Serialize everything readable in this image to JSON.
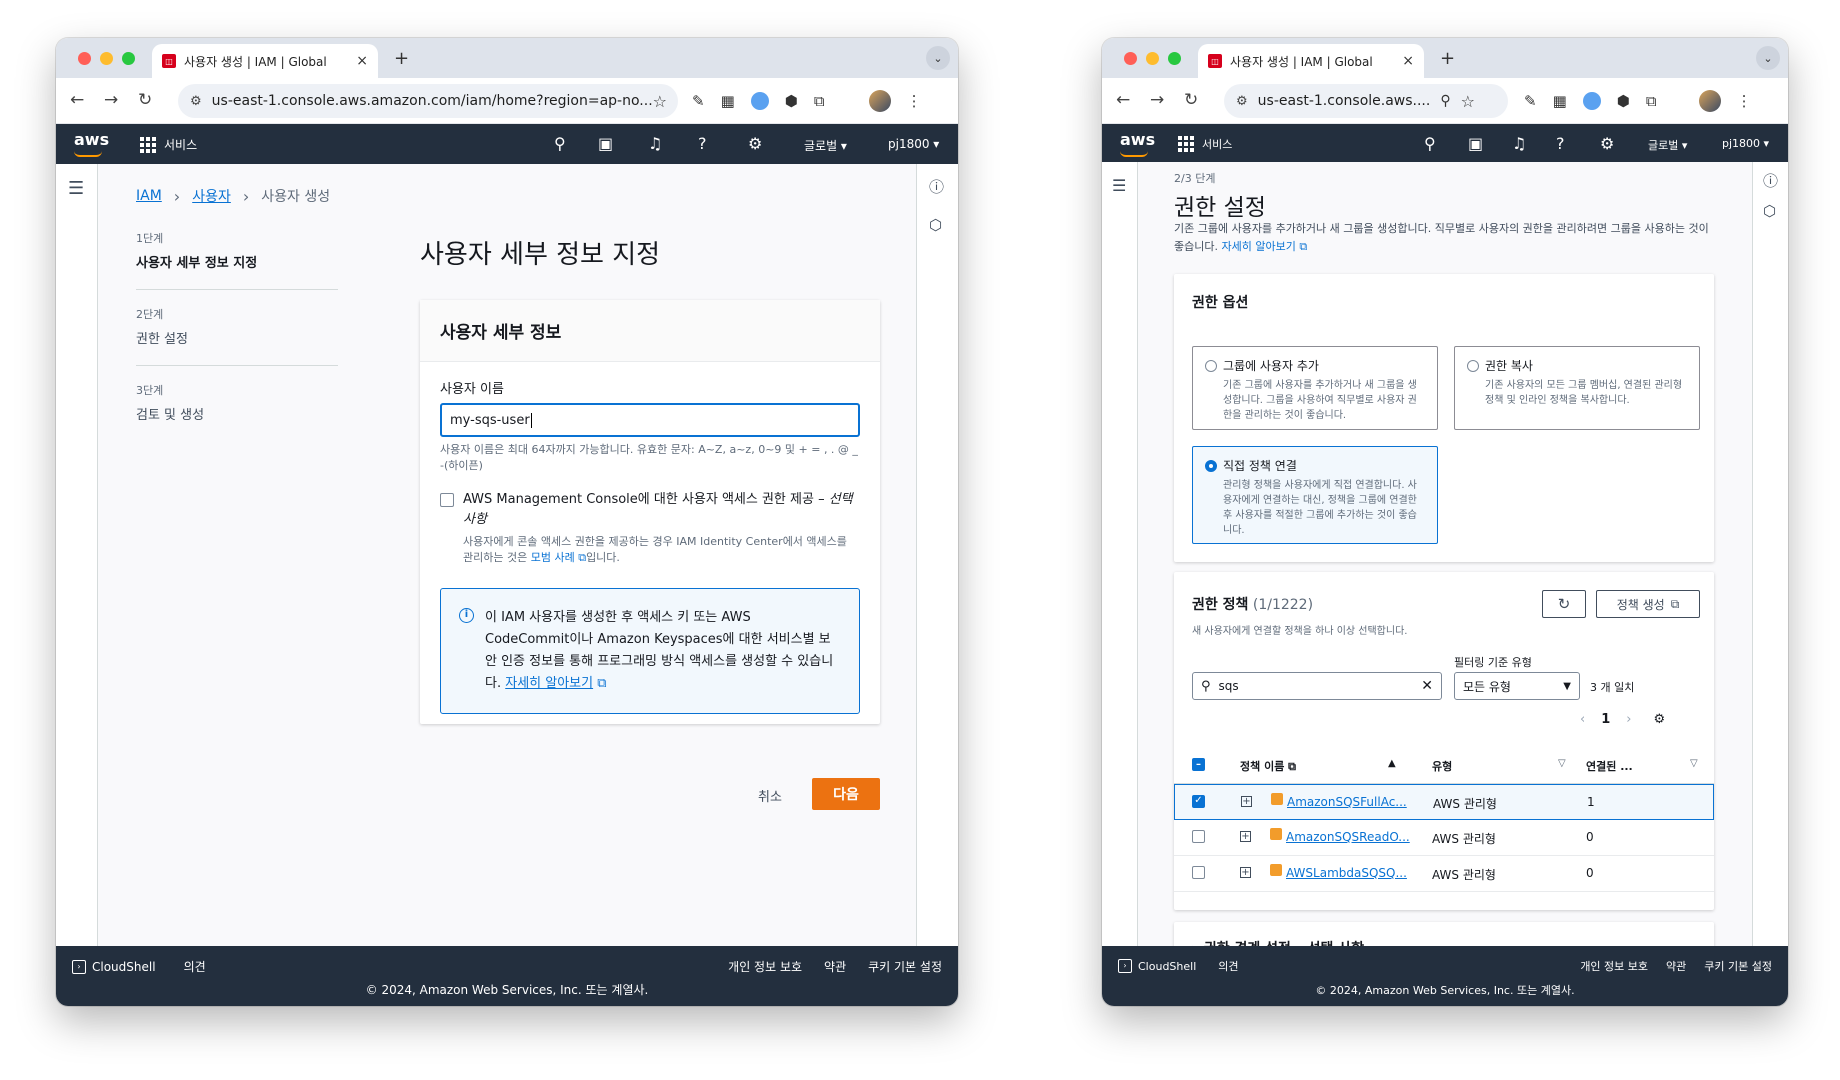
{
  "colors": {
    "aws_navy": "#232f3e",
    "aws_orange": "#ec7211",
    "link_blue": "#0972d3",
    "tab_bg": "#dee3eb"
  },
  "left_window": {
    "tab": {
      "title": "사용자 생성 | IAM | Global",
      "close": "×",
      "new": "+"
    },
    "url": "us-east-1.console.aws.amazon.com/iam/home?region=ap-no...",
    "awsbar": {
      "logo": "aws",
      "services": "서비스",
      "region": "글로벌 ▾",
      "account": "pj1800 ▾"
    },
    "breadcrumb": {
      "item1": "IAM",
      "item2": "사용자",
      "item3": "사용자 생성"
    },
    "steps": [
      {
        "num": "1단계",
        "title": "사용자 세부 정보 지정"
      },
      {
        "num": "2단계",
        "title": "권한 설정"
      },
      {
        "num": "3단계",
        "title": "검토 및 생성"
      }
    ],
    "page_title": "사용자 세부 정보 지정",
    "panel": {
      "header": "사용자 세부 정보",
      "username_label": "사용자 이름",
      "username_value": "my-sqs-user",
      "username_hint": "사용자 이름은 최대 64자까지 가능합니다. 유효한 문자: A~Z, a~z, 0~9 및 + = , . @ _ -(하이픈)",
      "console_checkbox_label": "AWS Management Console에 대한 사용자 액세스 권한 제공 – ",
      "console_checkbox_optional": "선택 사항",
      "console_hint_pre": "사용자에게 콘솔 액세스 권한을 제공하는 경우 IAM Identity Center에서 액세스를 관리하는 것은 ",
      "console_hint_link": "모범 사례",
      "console_hint_post": "입니다.",
      "info_text": "이 IAM 사용자를 생성한 후 액세스 키 또는 AWS CodeCommit이나 Amazon Keyspaces에 대한 서비스별 보안 인증 정보를 통해 프로그래밍 방식 액세스를 생성할 수 있습니다. ",
      "info_link": "자세히 알아보기"
    },
    "cancel": "취소",
    "next": "다음",
    "footer": {
      "cloudshell": "CloudShell",
      "feedback": "의견",
      "privacy": "개인 정보 보호",
      "terms": "약관",
      "cookies": "쿠키 기본 설정",
      "copyright": "© 2024, Amazon Web Services, Inc. 또는 계열사."
    }
  },
  "right_window": {
    "tab": {
      "title": "사용자 생성 | IAM | Global",
      "close": "×",
      "new": "+"
    },
    "url": "us-east-1.console.aws....",
    "awsbar": {
      "logo": "aws",
      "services": "서비스",
      "region": "글로벌 ▾",
      "account": "pj1800 ▾"
    },
    "step_label": "2/3 단계",
    "page_title": "권한 설정",
    "description": "기존 그룹에 사용자를 추가하거나 새 그룹을 생성합니다. 직무별로 사용자의 권한을 관리하려면 그룹을 사용하는 것이 좋습니다. ",
    "description_link": "자세히 알아보기",
    "options": {
      "header": "권한 옵션",
      "tiles": [
        {
          "title": "그룹에 사용자 추가",
          "desc": "기존 그룹에 사용자를 추가하거나 새 그룹을 생성합니다. 그룹을 사용하여 직무별로 사용자 권한을 관리하는 것이 좋습니다.",
          "selected": false
        },
        {
          "title": "권한 복사",
          "desc": "기존 사용자의 모든 그룹 멤버십, 연결된 관리형 정책 및 인라인 정책을 복사합니다.",
          "selected": false
        },
        {
          "title": "직접 정책 연결",
          "desc": "관리형 정책을 사용자에게 직접 연결합니다. 사용자에게 연결하는 대신, 정책을 그룹에 연결한 후 사용자를 적절한 그룹에 추가하는 것이 좋습니다.",
          "selected": true
        }
      ]
    },
    "policies": {
      "header": "권한 정책",
      "count": "(1/1222)",
      "subtitle": "새 사용자에게 연결할 정책을 하나 이상 선택합니다.",
      "create_policy": "정책 생성",
      "filter_label": "필터링 기준 유형",
      "search_value": "sqs",
      "type_select": "모든 유형",
      "match_count": "3 개 일치",
      "page": "1",
      "columns": {
        "name": "정책 이름",
        "type": "유형",
        "attached": "연결된 ..."
      },
      "rows": [
        {
          "name": "AmazonSQSFullAc...",
          "type": "AWS 관리형",
          "attached": "1",
          "checked": true
        },
        {
          "name": "AmazonSQSReadO...",
          "type": "AWS 관리형",
          "attached": "0",
          "checked": false
        },
        {
          "name": "AWSLambdaSQSQ...",
          "type": "AWS 관리형",
          "attached": "0",
          "checked": false
        }
      ]
    },
    "boundary_header": "▸ 권한 경계 설정 – 선택 사항",
    "footer": {
      "cloudshell": "CloudShell",
      "feedback": "의견",
      "privacy": "개인 정보 보호",
      "terms": "약관",
      "cookies": "쿠키 기본 설정",
      "copyright": "© 2024, Amazon Web Services, Inc. 또는 계열사."
    }
  }
}
